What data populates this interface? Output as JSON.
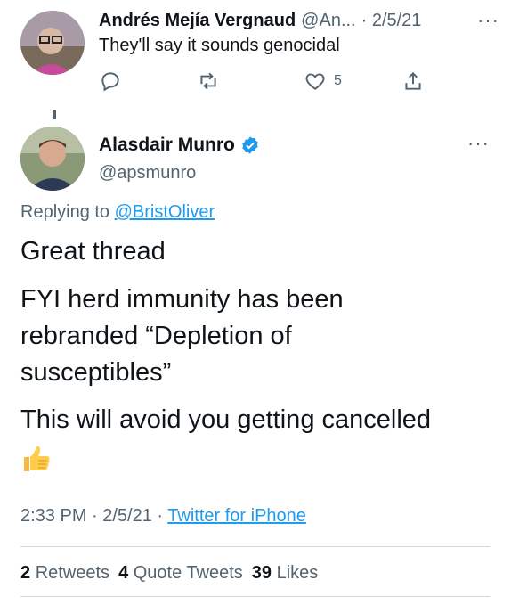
{
  "reply_tweet": {
    "author_name": "Andrés Mejía Vergnaud",
    "author_handle": "@An...",
    "date": "· 2/5/21",
    "text": "They'll say it sounds genocidal",
    "like_count": "5",
    "more_icon": "more-icon"
  },
  "main_tweet": {
    "author_name": "Alasdair Munro",
    "author_handle": "@apsmunro",
    "replying_prefix": "Replying to",
    "replying_to": "@BristOliver",
    "paragraphs": [
      "Great thread",
      "FYI herd immunity has been",
      "rebranded “Depletion of",
      "susceptibles”",
      "This will avoid you getting cancelled"
    ],
    "emoji": "👍",
    "time": "2:33 PM · 2/5/21 ·",
    "source": "Twitter for iPhone",
    "stats": {
      "retweets_count": "2",
      "retweets_label": "Retweets",
      "quotes_count": "4",
      "quotes_label": "Quote Tweets",
      "likes_count": "39",
      "likes_label": "Likes"
    }
  },
  "colors": {
    "text_primary": "#0f1419",
    "text_secondary": "#536471",
    "link": "#1d9bf0",
    "divider": "#cfd9de"
  }
}
